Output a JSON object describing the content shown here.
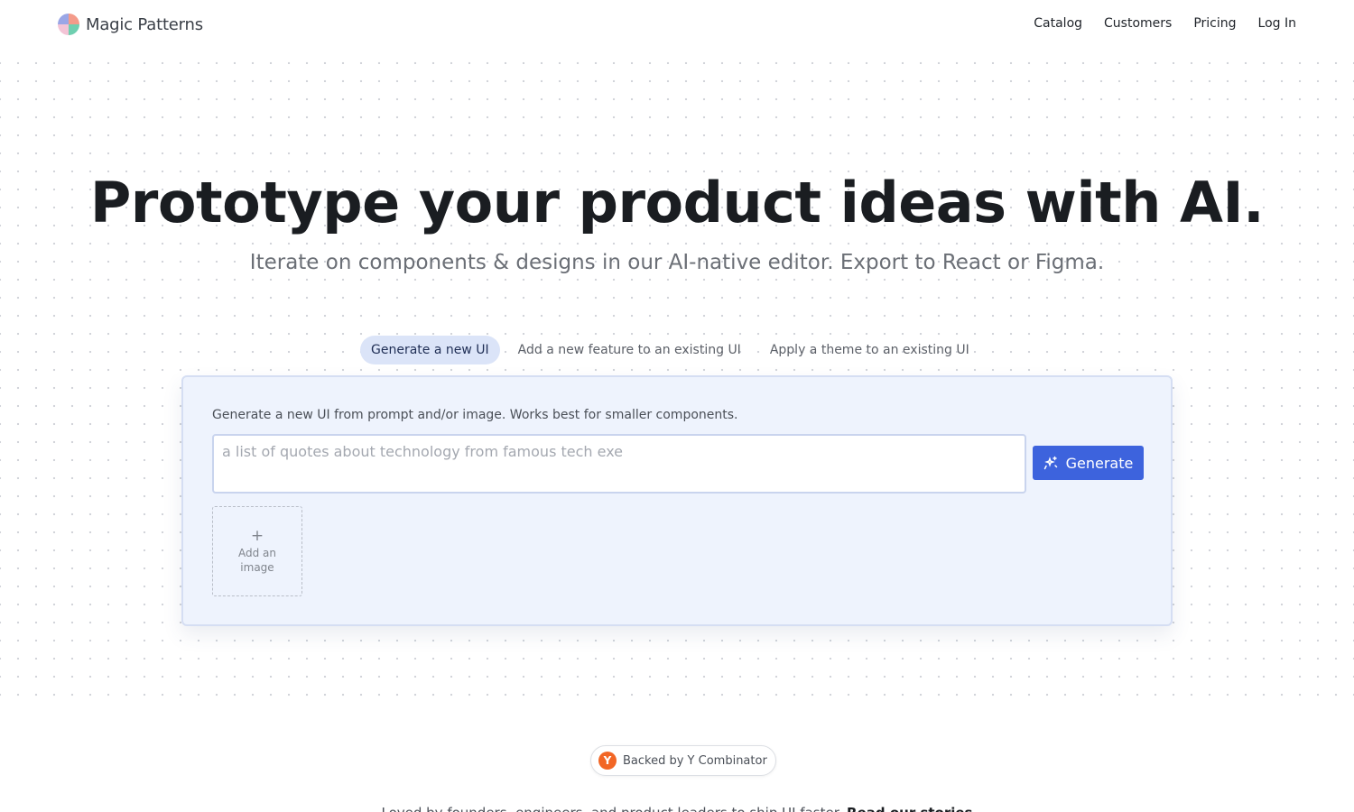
{
  "header": {
    "brand": "Magic Patterns",
    "nav": [
      "Catalog",
      "Customers",
      "Pricing",
      "Log In"
    ]
  },
  "hero": {
    "title": "Prototype your product ideas with AI.",
    "subtitle": "Iterate on components & designs in our AI-native editor. Export to React or Figma."
  },
  "tabs": [
    {
      "label": "Generate a new UI",
      "active": true
    },
    {
      "label": "Add a new feature to an existing UI",
      "active": false
    },
    {
      "label": "Apply a theme to an existing UI",
      "active": false
    }
  ],
  "generator": {
    "description": "Generate a new UI from prompt and/or image. Works best for smaller components.",
    "prompt_placeholder": "a list of quotes about technology from famous tech exe",
    "generate_label": "Generate",
    "add_image_label": "Add an image",
    "add_image_icon": "plus-icon"
  },
  "badge": {
    "logo_letter": "Y",
    "text": "Backed by Y Combinator"
  },
  "footer_teaser": {
    "text": "Loved by founders, engineers, and product leaders to ship UI faster.",
    "link": "Read our stories"
  },
  "colors": {
    "accent": "#3d63dd",
    "active_tab_bg": "#dbe4f8",
    "card_bg": "#eef3fd",
    "yc_orange": "#f26625"
  }
}
